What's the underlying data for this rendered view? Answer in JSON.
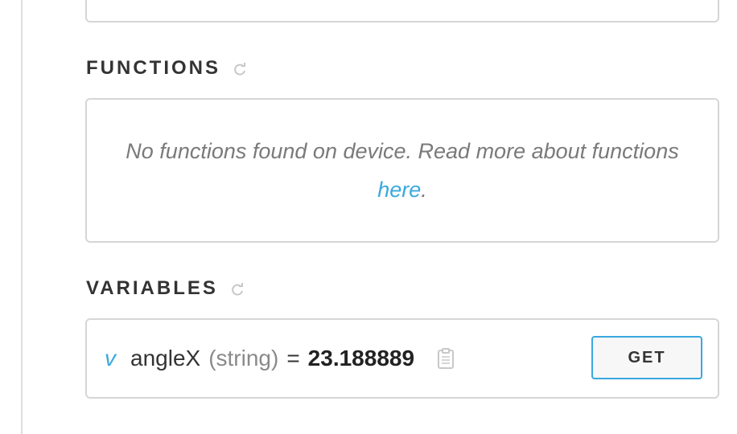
{
  "functions": {
    "title": "FUNCTIONS",
    "empty_message": "No functions found on device. Read more about functions",
    "link_text": "here",
    "trailing": "."
  },
  "variables": {
    "title": "VARIABLES",
    "items": [
      {
        "badge": "v",
        "name": "angleX",
        "type": "(string)",
        "equals": "=",
        "value": "23.188889",
        "button_label": "GET"
      }
    ]
  },
  "colors": {
    "accent": "#3aa8e0",
    "border": "#d6d6d6",
    "heading": "#333333",
    "muted": "#7a7a7a"
  },
  "icons": [
    "refresh-icon",
    "clipboard-icon"
  ]
}
